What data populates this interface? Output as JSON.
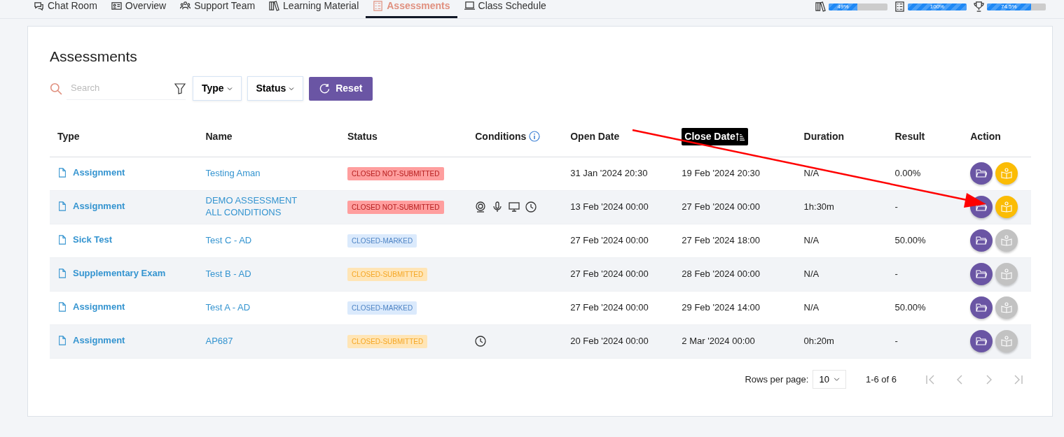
{
  "nav": {
    "tabs": [
      {
        "label": "Chat Room",
        "selected": false
      },
      {
        "label": "Overview",
        "selected": false
      },
      {
        "label": "Support Team",
        "selected": false
      },
      {
        "label": "Learning Material",
        "selected": false
      },
      {
        "label": "Assessments",
        "selected": true
      },
      {
        "label": "Class Schedule",
        "selected": false
      }
    ],
    "progress": [
      {
        "level": 0.49,
        "reading": "49%"
      },
      {
        "level": 1.0,
        "reading": "100%"
      },
      {
        "level": 0.745,
        "reading": "74.5%"
      }
    ]
  },
  "page_title": "Assessments",
  "filters": {
    "search": {
      "placeholder": "Search"
    },
    "dropdowns": [
      "Type",
      "Status"
    ],
    "reset": "Reset"
  },
  "table": {
    "columns": [
      {
        "label": "Type",
        "sorted": false,
        "info": false
      },
      {
        "label": "Name",
        "sorted": false,
        "info": false
      },
      {
        "label": "Status",
        "sorted": false,
        "info": false
      },
      {
        "label": "Conditions",
        "sorted": false,
        "info": true
      },
      {
        "label": "Open Date",
        "sorted": false,
        "info": false
      },
      {
        "label": "Close Date",
        "sorted": true,
        "info": false
      },
      {
        "label": "Duration",
        "sorted": false,
        "info": false
      },
      {
        "label": "Result",
        "sorted": false,
        "info": false
      },
      {
        "label": "Action",
        "sorted": false,
        "info": false
      }
    ],
    "rows": [
      {
        "type": "Assignment",
        "name": [
          "Testing Aman"
        ],
        "status": {
          "label": "CLOSED NOT-SUBMITTED",
          "kind": "danger"
        },
        "conditions": [],
        "open": "31 Jan '2024 20:30",
        "close": "19 Feb '2024 20:30",
        "duration": "N/A",
        "result": "0.00%",
        "learn_disabled": false
      },
      {
        "type": "Assignment",
        "name": [
          "DEMO ASSESSMENT",
          "ALL CONDITIONS"
        ],
        "status": {
          "label": "CLOSED NOT-SUBMITTED",
          "kind": "danger"
        },
        "conditions": [
          {
            "kind": "webcam"
          },
          {
            "kind": "mic"
          },
          {
            "kind": "screen"
          },
          {
            "kind": "clock"
          }
        ],
        "open": "13 Feb '2024 00:00",
        "close": "27 Feb '2024 00:00",
        "duration": "1h:30m",
        "result": "-",
        "learn_disabled": false
      },
      {
        "type": "Sick Test",
        "name": [
          "Test C - AD"
        ],
        "status": {
          "label": "CLOSED-MARKED",
          "kind": "info"
        },
        "conditions": [],
        "open": "27 Feb '2024 00:00",
        "close": "27 Feb '2024 18:00",
        "duration": "N/A",
        "result": "50.00%",
        "learn_disabled": true
      },
      {
        "type": "Supplementary Exam",
        "name": [
          "Test B - AD"
        ],
        "status": {
          "label": "CLOSED-SUBMITTED",
          "kind": "warning"
        },
        "conditions": [],
        "open": "27 Feb '2024 00:00",
        "close": "28 Feb '2024 00:00",
        "duration": "N/A",
        "result": "-",
        "learn_disabled": true
      },
      {
        "type": "Assignment",
        "name": [
          "Test A - AD"
        ],
        "status": {
          "label": "CLOSED-MARKED",
          "kind": "info"
        },
        "conditions": [],
        "open": "27 Feb '2024 00:00",
        "close": "29 Feb '2024 14:00",
        "duration": "N/A",
        "result": "50.00%",
        "learn_disabled": true
      },
      {
        "type": "Assignment",
        "name": [
          "AP687"
        ],
        "status": {
          "label": "CLOSED-SUBMITTED",
          "kind": "warning"
        },
        "conditions": [
          {
            "kind": "clock"
          }
        ],
        "open": "20 Feb '2024 00:00",
        "close": "2 Mar '2024 00:00",
        "duration": "0h:20m",
        "result": "-",
        "learn_disabled": true
      }
    ]
  },
  "pagination": {
    "rows_label": "Rows per page:",
    "rows_value": "10",
    "range": "1-6 of 6"
  },
  "annotation_arrow": true
}
